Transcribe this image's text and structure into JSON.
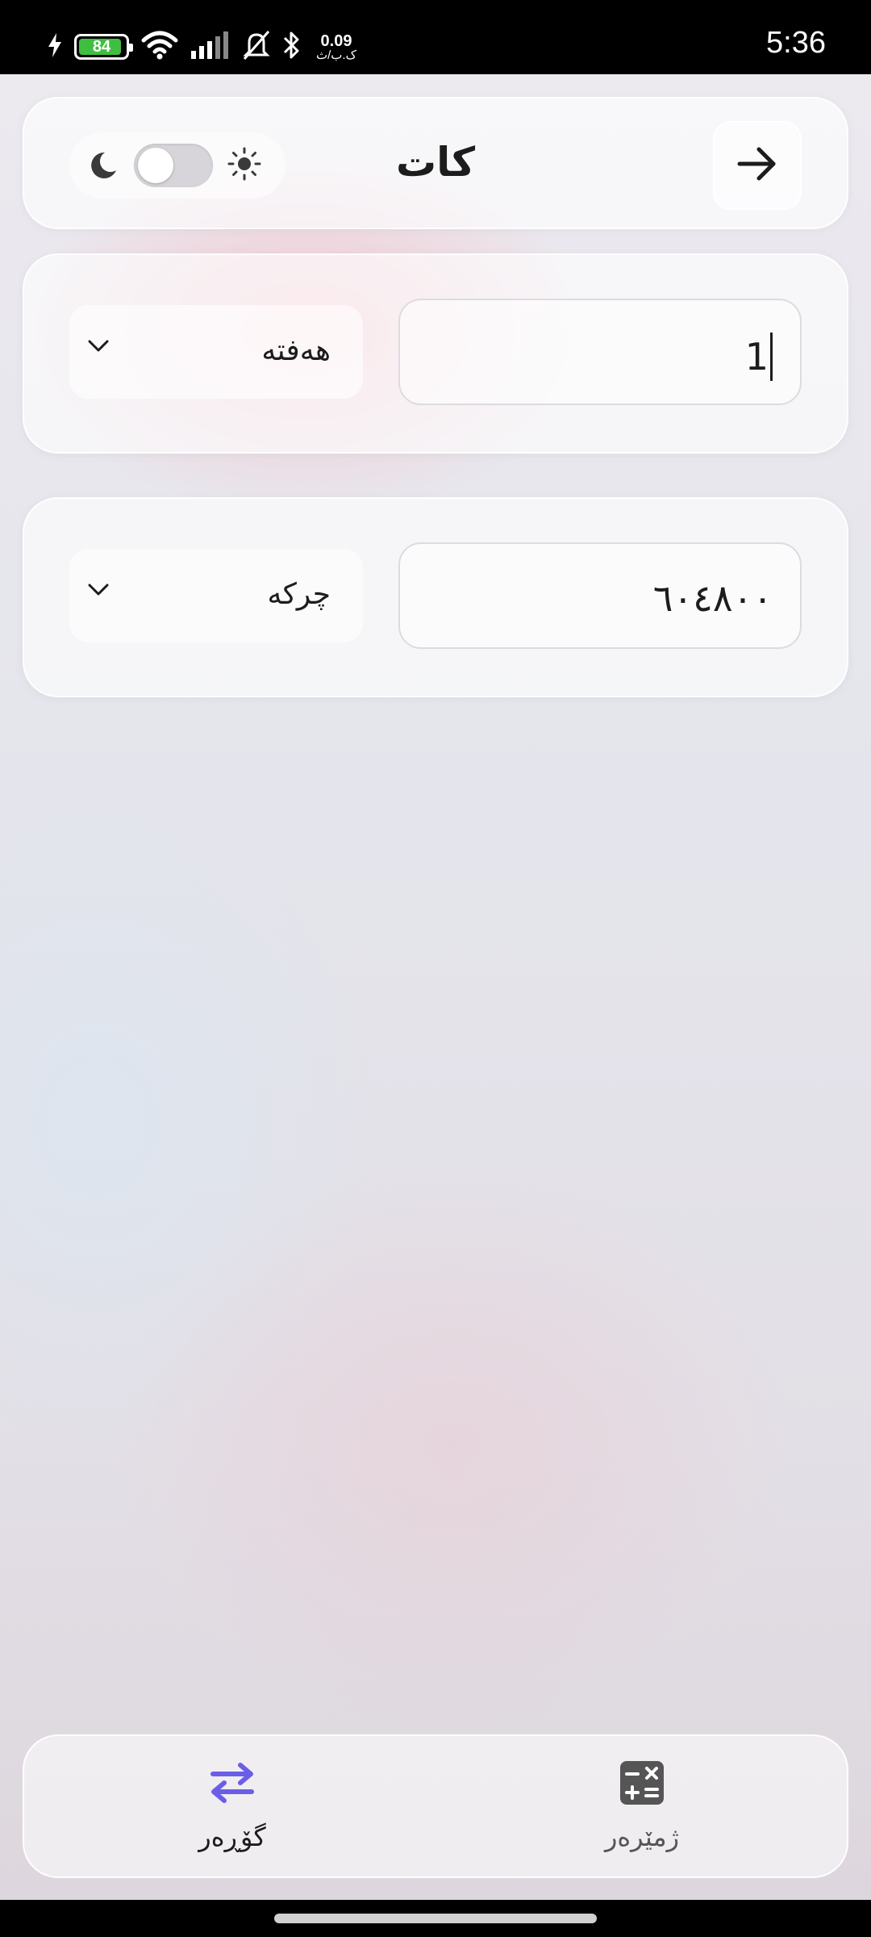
{
  "status_bar": {
    "battery_level": "84",
    "net_speed_value": "0.09",
    "net_speed_unit": "ک.ب/ث",
    "time": "5:36"
  },
  "header": {
    "title": "کات",
    "theme_mode": "light"
  },
  "converter": {
    "from": {
      "value": "1",
      "unit": "هەفتە"
    },
    "to": {
      "value": "٦٠٤٨٠٠",
      "unit": "چرکە"
    }
  },
  "bottom_nav": {
    "items": [
      {
        "label": "گۆڕەر",
        "icon": "swap-arrows-icon",
        "active": true
      },
      {
        "label": "ژمێرەر",
        "icon": "calculator-icon",
        "active": false
      }
    ]
  },
  "colors": {
    "accent": "#6b5ee6",
    "calc_icon": "#555555"
  }
}
